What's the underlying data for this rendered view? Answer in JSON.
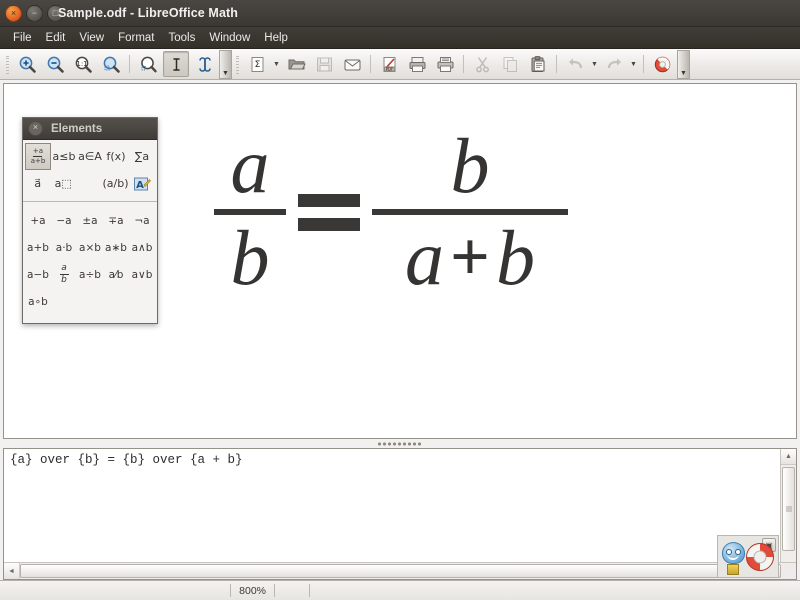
{
  "window": {
    "title": "Sample.odf - LibreOffice Math",
    "close_icon": "close-icon",
    "minimize_icon": "minimize-icon",
    "maximize_icon": "maximize-icon",
    "close_glyph": "×",
    "minimize_glyph": "−",
    "maximize_glyph": "□"
  },
  "menu": {
    "items": [
      {
        "label": "File",
        "accel": "F"
      },
      {
        "label": "Edit",
        "accel": "E"
      },
      {
        "label": "View",
        "accel": "V"
      },
      {
        "label": "Format",
        "accel": "o"
      },
      {
        "label": "Tools",
        "accel": "T"
      },
      {
        "label": "Window",
        "accel": "W"
      },
      {
        "label": "Help",
        "accel": "H"
      }
    ]
  },
  "toolbar": {
    "buttons": [
      {
        "name": "zoom-in-icon",
        "label": "Zoom In",
        "enabled": true,
        "active": false
      },
      {
        "name": "zoom-out-icon",
        "label": "Zoom Out",
        "enabled": true,
        "active": false
      },
      {
        "name": "zoom-100-icon",
        "label": "Zoom 100%",
        "enabled": true,
        "active": false
      },
      {
        "name": "zoom-fit-icon",
        "label": "Show All",
        "enabled": true,
        "active": false
      },
      {
        "name": "refresh-view-icon",
        "label": "Update",
        "enabled": true,
        "active": false
      },
      {
        "name": "formula-cursor-icon",
        "label": "Formula Cursor",
        "enabled": true,
        "active": true
      },
      {
        "name": "elements-icon",
        "label": "Elements",
        "enabled": true,
        "active": false
      },
      {
        "name": "new-formula-icon",
        "label": "New",
        "enabled": true,
        "active": false
      },
      {
        "name": "open-icon",
        "label": "Open",
        "enabled": true,
        "active": false
      },
      {
        "name": "save-icon",
        "label": "Save",
        "enabled": false,
        "active": false
      },
      {
        "name": "email-icon",
        "label": "Attach to E-mail",
        "enabled": true,
        "active": false
      },
      {
        "name": "export-pdf-icon",
        "label": "Export as PDF",
        "enabled": true,
        "active": false
      },
      {
        "name": "print-icon",
        "label": "Print",
        "enabled": true,
        "active": false
      },
      {
        "name": "print-preview-icon",
        "label": "Print Preview",
        "enabled": true,
        "active": false
      },
      {
        "name": "cut-icon",
        "label": "Cut",
        "enabled": false,
        "active": false
      },
      {
        "name": "copy-icon",
        "label": "Copy",
        "enabled": false,
        "active": false
      },
      {
        "name": "paste-icon",
        "label": "Paste",
        "enabled": true,
        "active": false
      },
      {
        "name": "undo-icon",
        "label": "Undo",
        "enabled": false,
        "active": false
      },
      {
        "name": "redo-icon",
        "label": "Redo",
        "enabled": false,
        "active": false
      },
      {
        "name": "help-icon",
        "label": "LibreOffice Help",
        "enabled": true,
        "active": false
      }
    ],
    "dropdown_glyph": "▼",
    "overflow_glyph": "▼"
  },
  "elements_panel": {
    "title": "Elements",
    "close_glyph": "×",
    "close_icon": "close-icon",
    "categories": [
      {
        "name": "category-unary-binary",
        "label": "+a/a+b",
        "selected": true
      },
      {
        "name": "category-relations",
        "label": "a≤b",
        "selected": false
      },
      {
        "name": "category-set-ops",
        "label": "a∈A",
        "selected": false
      },
      {
        "name": "category-functions",
        "label": "f(x)",
        "selected": false
      },
      {
        "name": "category-operators",
        "label": "∑a",
        "selected": false
      },
      {
        "name": "category-attributes",
        "label": "a⃗",
        "selected": false
      },
      {
        "name": "category-brackets",
        "label": "a⬚",
        "selected": false
      },
      {
        "name": "category-formats",
        "label": "(a/b)",
        "selected": false
      },
      {
        "name": "category-others",
        "label": "A",
        "selected": false
      }
    ],
    "operators": [
      "+a",
      "−a",
      "±a",
      "∓a",
      "¬a",
      "a+b",
      "a·b",
      "a×b",
      "a∗b",
      "a∧b",
      "a−b",
      "a/b",
      "a÷b",
      "a⁄b",
      "a∨b",
      "a∘b"
    ]
  },
  "formula": {
    "left": {
      "numerator": "a",
      "denominator": "b"
    },
    "relation": "=",
    "right": {
      "numerator": "b",
      "denominator_left": "a",
      "denominator_op": "+",
      "denominator_right": "b"
    }
  },
  "command_editor": {
    "text": "{a} over {b} = {b} over {a + b}",
    "vscroll_up_glyph": "▲",
    "hscroll_left_glyph": "◄"
  },
  "statusbar": {
    "zoom": "800%"
  },
  "help_agent": {
    "name": "help-agent",
    "badge_glyph": "▣"
  },
  "colors": {
    "titlebar": "#3b3733",
    "close_button": "#de5d20",
    "canvas": "#ffffff",
    "formula_ink": "#3a3836",
    "toolbar_bg": "#ece9e6"
  }
}
